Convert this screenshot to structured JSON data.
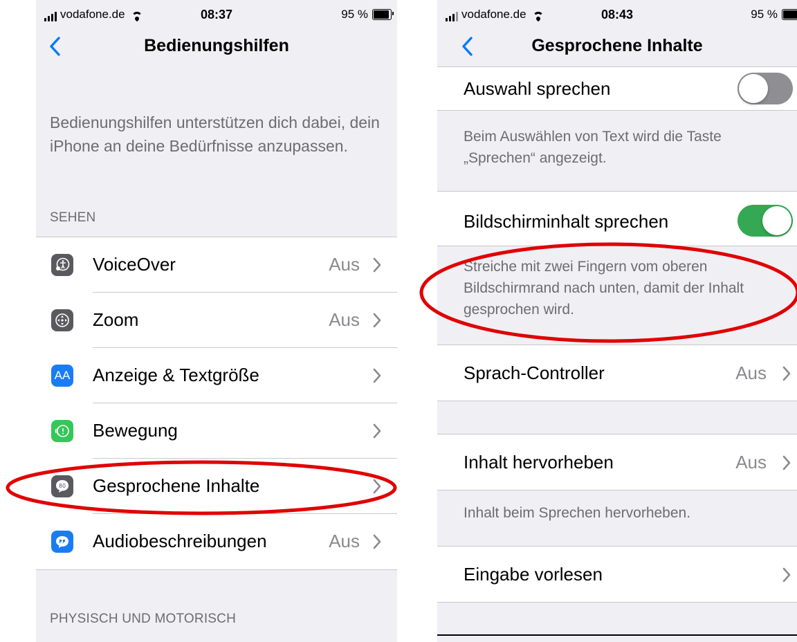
{
  "left_screen": {
    "status": {
      "carrier": "vodafone.de",
      "time": "08:37",
      "battery": "95 %"
    },
    "nav_title": "Bedienungshilfen",
    "description": "Bedienungshilfen unterstützen dich dabei, dein iPhone an deine Bedürfnisse anzupassen.",
    "section_header": "SEHEN",
    "items": [
      {
        "label": "VoiceOver",
        "value": "Aus",
        "icon": "voiceover-icon",
        "color": "#5a5a5e"
      },
      {
        "label": "Zoom",
        "value": "Aus",
        "icon": "zoom-icon",
        "color": "#5a5a5e"
      },
      {
        "label": "Anzeige & Textgröße",
        "value": "",
        "icon": "display-text-size-icon",
        "icon_text": "AA",
        "color": "#1a7cf5"
      },
      {
        "label": "Bewegung",
        "value": "",
        "icon": "motion-icon",
        "color": "#34c759"
      },
      {
        "label": "Gesprochene Inhalte",
        "value": "",
        "icon": "spoken-content-icon",
        "color": "#5a5a5e"
      },
      {
        "label": "Audiobeschreibungen",
        "value": "Aus",
        "icon": "audio-descriptions-icon",
        "color": "#1a7cf5"
      }
    ],
    "section_header_2": "PHYSISCH UND MOTORISCH"
  },
  "right_screen": {
    "status": {
      "carrier": "vodafone.de",
      "time": "08:43",
      "battery": "95 %"
    },
    "nav_title": "Gesprochene Inhalte",
    "speak_selection": {
      "label": "Auswahl sprechen",
      "enabled": false
    },
    "speak_selection_footer": "Beim Auswählen von Text wird die Taste „Sprechen“ angezeigt.",
    "speak_screen": {
      "label": "Bildschirminhalt sprechen",
      "enabled": true
    },
    "speak_screen_footer": "Streiche mit zwei Fingern vom oberen Bildschirmrand nach unten, damit der Inhalt gesprochen wird.",
    "speech_controller": {
      "label": "Sprach-Controller",
      "value": "Aus"
    },
    "highlight_content": {
      "label": "Inhalt hervorheben",
      "value": "Aus"
    },
    "highlight_footer": "Inhalt beim Sprechen hervorheben.",
    "typing_feedback": {
      "label": "Eingabe vorlesen"
    }
  },
  "colors": {
    "accent": "#007aff",
    "toggle_on": "#34a853",
    "annotation": "#e00000",
    "background": "#efeff4"
  }
}
